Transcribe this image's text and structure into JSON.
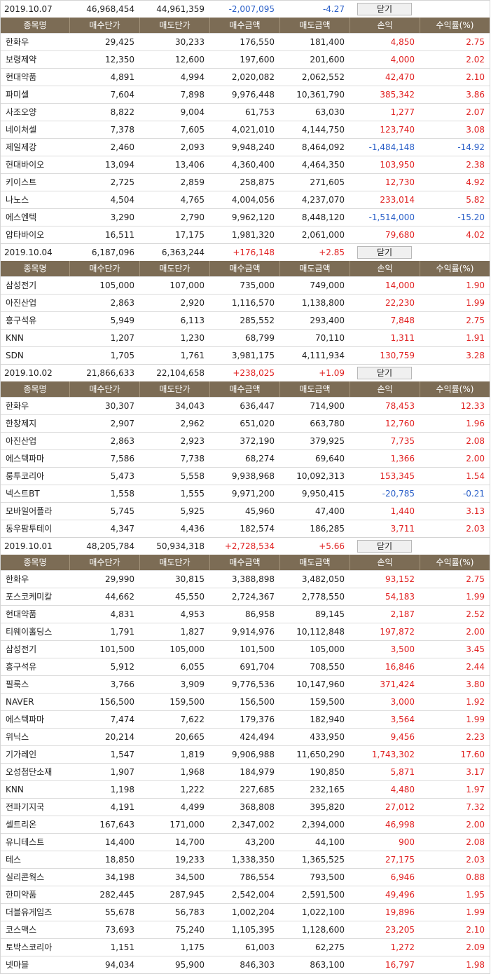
{
  "close_label": "닫기",
  "header": {
    "name": "종목명",
    "buy_price": "매수단가",
    "sell_price": "매도단가",
    "buy_amount": "매수금액",
    "sell_amount": "매도금액",
    "profit": "손익",
    "return": "수익률(%)"
  },
  "colors": {
    "header_bg": "#7c6c55",
    "positive": "#e02020",
    "negative": "#2a5fc8"
  },
  "days": [
    {
      "date": "2019.10.07",
      "buy_total": "46,968,454",
      "sell_total": "44,961,359",
      "profit": "-2,007,095",
      "return": "-4.27",
      "sign": "neg",
      "rows": [
        {
          "name": "한화우",
          "buy": "29,425",
          "sell": "30,233",
          "buy_amt": "176,550",
          "sell_amt": "181,400",
          "profit": "4,850",
          "ret": "2.75",
          "sign": "pos"
        },
        {
          "name": "보령제약",
          "buy": "12,350",
          "sell": "12,600",
          "buy_amt": "197,600",
          "sell_amt": "201,600",
          "profit": "4,000",
          "ret": "2.02",
          "sign": "pos"
        },
        {
          "name": "현대약품",
          "buy": "4,891",
          "sell": "4,994",
          "buy_amt": "2,020,082",
          "sell_amt": "2,062,552",
          "profit": "42,470",
          "ret": "2.10",
          "sign": "pos"
        },
        {
          "name": "파미셀",
          "buy": "7,604",
          "sell": "7,898",
          "buy_amt": "9,976,448",
          "sell_amt": "10,361,790",
          "profit": "385,342",
          "ret": "3.86",
          "sign": "pos"
        },
        {
          "name": "사조오양",
          "buy": "8,822",
          "sell": "9,004",
          "buy_amt": "61,753",
          "sell_amt": "63,030",
          "profit": "1,277",
          "ret": "2.07",
          "sign": "pos"
        },
        {
          "name": "네이처셀",
          "buy": "7,378",
          "sell": "7,605",
          "buy_amt": "4,021,010",
          "sell_amt": "4,144,750",
          "profit": "123,740",
          "ret": "3.08",
          "sign": "pos"
        },
        {
          "name": "제일제강",
          "buy": "2,460",
          "sell": "2,093",
          "buy_amt": "9,948,240",
          "sell_amt": "8,464,092",
          "profit": "-1,484,148",
          "ret": "-14.92",
          "sign": "neg"
        },
        {
          "name": "현대바이오",
          "buy": "13,094",
          "sell": "13,406",
          "buy_amt": "4,360,400",
          "sell_amt": "4,464,350",
          "profit": "103,950",
          "ret": "2.38",
          "sign": "pos"
        },
        {
          "name": "키이스트",
          "buy": "2,725",
          "sell": "2,859",
          "buy_amt": "258,875",
          "sell_amt": "271,605",
          "profit": "12,730",
          "ret": "4.92",
          "sign": "pos"
        },
        {
          "name": "나노스",
          "buy": "4,504",
          "sell": "4,765",
          "buy_amt": "4,004,056",
          "sell_amt": "4,237,070",
          "profit": "233,014",
          "ret": "5.82",
          "sign": "pos"
        },
        {
          "name": "에스엔텍",
          "buy": "3,290",
          "sell": "2,790",
          "buy_amt": "9,962,120",
          "sell_amt": "8,448,120",
          "profit": "-1,514,000",
          "ret": "-15.20",
          "sign": "neg"
        },
        {
          "name": "압타바이오",
          "buy": "16,511",
          "sell": "17,175",
          "buy_amt": "1,981,320",
          "sell_amt": "2,061,000",
          "profit": "79,680",
          "ret": "4.02",
          "sign": "pos"
        }
      ]
    },
    {
      "date": "2019.10.04",
      "buy_total": "6,187,096",
      "sell_total": "6,363,244",
      "profit": "+176,148",
      "return": "+2.85",
      "sign": "pos",
      "rows": [
        {
          "name": "삼성전기",
          "buy": "105,000",
          "sell": "107,000",
          "buy_amt": "735,000",
          "sell_amt": "749,000",
          "profit": "14,000",
          "ret": "1.90",
          "sign": "pos"
        },
        {
          "name": "아진산업",
          "buy": "2,863",
          "sell": "2,920",
          "buy_amt": "1,116,570",
          "sell_amt": "1,138,800",
          "profit": "22,230",
          "ret": "1.99",
          "sign": "pos"
        },
        {
          "name": "흥구석유",
          "buy": "5,949",
          "sell": "6,113",
          "buy_amt": "285,552",
          "sell_amt": "293,400",
          "profit": "7,848",
          "ret": "2.75",
          "sign": "pos"
        },
        {
          "name": "KNN",
          "buy": "1,207",
          "sell": "1,230",
          "buy_amt": "68,799",
          "sell_amt": "70,110",
          "profit": "1,311",
          "ret": "1.91",
          "sign": "pos"
        },
        {
          "name": "SDN",
          "buy": "1,705",
          "sell": "1,761",
          "buy_amt": "3,981,175",
          "sell_amt": "4,111,934",
          "profit": "130,759",
          "ret": "3.28",
          "sign": "pos"
        }
      ]
    },
    {
      "date": "2019.10.02",
      "buy_total": "21,866,633",
      "sell_total": "22,104,658",
      "profit": "+238,025",
      "return": "+1.09",
      "sign": "pos",
      "rows": [
        {
          "name": "한화우",
          "buy": "30,307",
          "sell": "34,043",
          "buy_amt": "636,447",
          "sell_amt": "714,900",
          "profit": "78,453",
          "ret": "12.33",
          "sign": "pos"
        },
        {
          "name": "한창제지",
          "buy": "2,907",
          "sell": "2,962",
          "buy_amt": "651,020",
          "sell_amt": "663,780",
          "profit": "12,760",
          "ret": "1.96",
          "sign": "pos"
        },
        {
          "name": "아진산업",
          "buy": "2,863",
          "sell": "2,923",
          "buy_amt": "372,190",
          "sell_amt": "379,925",
          "profit": "7,735",
          "ret": "2.08",
          "sign": "pos"
        },
        {
          "name": "에스텍파마",
          "buy": "7,586",
          "sell": "7,738",
          "buy_amt": "68,274",
          "sell_amt": "69,640",
          "profit": "1,366",
          "ret": "2.00",
          "sign": "pos"
        },
        {
          "name": "룽투코리아",
          "buy": "5,473",
          "sell": "5,558",
          "buy_amt": "9,938,968",
          "sell_amt": "10,092,313",
          "profit": "153,345",
          "ret": "1.54",
          "sign": "pos"
        },
        {
          "name": "넥스트BT",
          "buy": "1,558",
          "sell": "1,555",
          "buy_amt": "9,971,200",
          "sell_amt": "9,950,415",
          "profit": "-20,785",
          "ret": "-0.21",
          "sign": "neg"
        },
        {
          "name": "모바일어플라",
          "buy": "5,745",
          "sell": "5,925",
          "buy_amt": "45,960",
          "sell_amt": "47,400",
          "profit": "1,440",
          "ret": "3.13",
          "sign": "pos"
        },
        {
          "name": "동우팜투테이",
          "buy": "4,347",
          "sell": "4,436",
          "buy_amt": "182,574",
          "sell_amt": "186,285",
          "profit": "3,711",
          "ret": "2.03",
          "sign": "pos"
        }
      ]
    },
    {
      "date": "2019.10.01",
      "buy_total": "48,205,784",
      "sell_total": "50,934,318",
      "profit": "+2,728,534",
      "return": "+5.66",
      "sign": "pos",
      "rows": [
        {
          "name": "한화우",
          "buy": "29,990",
          "sell": "30,815",
          "buy_amt": "3,388,898",
          "sell_amt": "3,482,050",
          "profit": "93,152",
          "ret": "2.75",
          "sign": "pos"
        },
        {
          "name": "포스코케미칼",
          "buy": "44,662",
          "sell": "45,550",
          "buy_amt": "2,724,367",
          "sell_amt": "2,778,550",
          "profit": "54,183",
          "ret": "1.99",
          "sign": "pos"
        },
        {
          "name": "현대약품",
          "buy": "4,831",
          "sell": "4,953",
          "buy_amt": "86,958",
          "sell_amt": "89,145",
          "profit": "2,187",
          "ret": "2.52",
          "sign": "pos"
        },
        {
          "name": "티웨이홀딩스",
          "buy": "1,791",
          "sell": "1,827",
          "buy_amt": "9,914,976",
          "sell_amt": "10,112,848",
          "profit": "197,872",
          "ret": "2.00",
          "sign": "pos"
        },
        {
          "name": "삼성전기",
          "buy": "101,500",
          "sell": "105,000",
          "buy_amt": "101,500",
          "sell_amt": "105,000",
          "profit": "3,500",
          "ret": "3.45",
          "sign": "pos"
        },
        {
          "name": "흥구석유",
          "buy": "5,912",
          "sell": "6,055",
          "buy_amt": "691,704",
          "sell_amt": "708,550",
          "profit": "16,846",
          "ret": "2.44",
          "sign": "pos"
        },
        {
          "name": "필룩스",
          "buy": "3,766",
          "sell": "3,909",
          "buy_amt": "9,776,536",
          "sell_amt": "10,147,960",
          "profit": "371,424",
          "ret": "3.80",
          "sign": "pos"
        },
        {
          "name": "NAVER",
          "buy": "156,500",
          "sell": "159,500",
          "buy_amt": "156,500",
          "sell_amt": "159,500",
          "profit": "3,000",
          "ret": "1.92",
          "sign": "pos"
        },
        {
          "name": "에스텍파마",
          "buy": "7,474",
          "sell": "7,622",
          "buy_amt": "179,376",
          "sell_amt": "182,940",
          "profit": "3,564",
          "ret": "1.99",
          "sign": "pos"
        },
        {
          "name": "위닉스",
          "buy": "20,214",
          "sell": "20,665",
          "buy_amt": "424,494",
          "sell_amt": "433,950",
          "profit": "9,456",
          "ret": "2.23",
          "sign": "pos"
        },
        {
          "name": "기가레인",
          "buy": "1,547",
          "sell": "1,819",
          "buy_amt": "9,906,988",
          "sell_amt": "11,650,290",
          "profit": "1,743,302",
          "ret": "17.60",
          "sign": "pos"
        },
        {
          "name": "오성첨단소재",
          "buy": "1,907",
          "sell": "1,968",
          "buy_amt": "184,979",
          "sell_amt": "190,850",
          "profit": "5,871",
          "ret": "3.17",
          "sign": "pos"
        },
        {
          "name": "KNN",
          "buy": "1,198",
          "sell": "1,222",
          "buy_amt": "227,685",
          "sell_amt": "232,165",
          "profit": "4,480",
          "ret": "1.97",
          "sign": "pos"
        },
        {
          "name": "전파기지국",
          "buy": "4,191",
          "sell": "4,499",
          "buy_amt": "368,808",
          "sell_amt": "395,820",
          "profit": "27,012",
          "ret": "7.32",
          "sign": "pos"
        },
        {
          "name": "셀트리온",
          "buy": "167,643",
          "sell": "171,000",
          "buy_amt": "2,347,002",
          "sell_amt": "2,394,000",
          "profit": "46,998",
          "ret": "2.00",
          "sign": "pos"
        },
        {
          "name": "유니테스트",
          "buy": "14,400",
          "sell": "14,700",
          "buy_amt": "43,200",
          "sell_amt": "44,100",
          "profit": "900",
          "ret": "2.08",
          "sign": "pos"
        },
        {
          "name": "테스",
          "buy": "18,850",
          "sell": "19,233",
          "buy_amt": "1,338,350",
          "sell_amt": "1,365,525",
          "profit": "27,175",
          "ret": "2.03",
          "sign": "pos"
        },
        {
          "name": "실리콘웍스",
          "buy": "34,198",
          "sell": "34,500",
          "buy_amt": "786,554",
          "sell_amt": "793,500",
          "profit": "6,946",
          "ret": "0.88",
          "sign": "pos"
        },
        {
          "name": "한미약품",
          "buy": "282,445",
          "sell": "287,945",
          "buy_amt": "2,542,004",
          "sell_amt": "2,591,500",
          "profit": "49,496",
          "ret": "1.95",
          "sign": "pos"
        },
        {
          "name": "더블유게임즈",
          "buy": "55,678",
          "sell": "56,783",
          "buy_amt": "1,002,204",
          "sell_amt": "1,022,100",
          "profit": "19,896",
          "ret": "1.99",
          "sign": "pos"
        },
        {
          "name": "코스맥스",
          "buy": "73,693",
          "sell": "75,240",
          "buy_amt": "1,105,395",
          "sell_amt": "1,128,600",
          "profit": "23,205",
          "ret": "2.10",
          "sign": "pos"
        },
        {
          "name": "토박스코리아",
          "buy": "1,151",
          "sell": "1,175",
          "buy_amt": "61,003",
          "sell_amt": "62,275",
          "profit": "1,272",
          "ret": "2.09",
          "sign": "pos"
        },
        {
          "name": "넷마블",
          "buy": "94,034",
          "sell": "95,900",
          "buy_amt": "846,303",
          "sell_amt": "863,100",
          "profit": "16,797",
          "ret": "1.98",
          "sign": "pos"
        }
      ]
    }
  ]
}
